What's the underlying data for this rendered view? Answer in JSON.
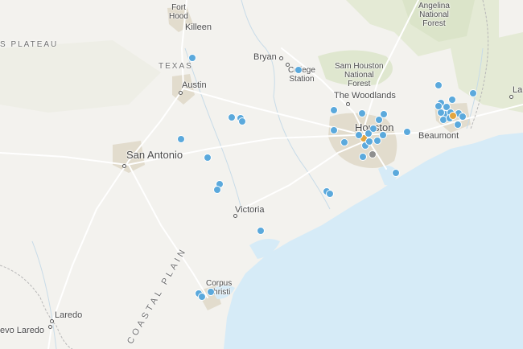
{
  "colors": {
    "water": "#d6ebf7",
    "land": "#f3f2ee",
    "urban": "#e3ddcf",
    "forest": "#e2e8d3",
    "road": "#ffffff",
    "marker_blue": "#5ba9dc",
    "marker_orange": "#e2a540",
    "marker_gray": "#8f8f8f"
  },
  "labels": {
    "fort_hood": "Fort\nHood",
    "killeen": "Killeen",
    "plateau": "S PLATEAU",
    "texas": "TEXAS",
    "austin": "Austin",
    "bryan": "Bryan",
    "college_station": "College\nStation",
    "sam_houston": "Sam Houston\nNational\nForest",
    "angelina": "Angelina\nNational\nForest",
    "woodlands": "The Woodlands",
    "houston": "Houston",
    "beaumont": "Beaumont",
    "la": "La",
    "san_antonio": "San Antonio",
    "victoria": "Victoria",
    "coastal_plain": "COASTAL PLAIN",
    "corpus": "Corpus\nChristi",
    "laredo": "Laredo",
    "nuevo_laredo": "evo Laredo"
  },
  "markers": [
    {
      "color": "blue"
    },
    {
      "color": "blue"
    },
    {
      "color": "blue"
    },
    {
      "color": "blue"
    },
    {
      "color": "blue"
    },
    {
      "color": "blue"
    },
    {
      "color": "blue"
    },
    {
      "color": "blue"
    },
    {
      "color": "blue"
    },
    {
      "color": "blue"
    },
    {
      "color": "blue"
    },
    {
      "color": "blue"
    },
    {
      "color": "blue"
    },
    {
      "color": "blue"
    },
    {
      "color": "blue"
    },
    {
      "color": "blue"
    },
    {
      "color": "blue"
    },
    {
      "color": "blue"
    },
    {
      "color": "blue"
    },
    {
      "color": "blue"
    },
    {
      "color": "blue"
    },
    {
      "color": "blue"
    },
    {
      "color": "blue"
    },
    {
      "color": "orange"
    },
    {
      "color": "gray"
    },
    {
      "color": "blue"
    },
    {
      "color": "blue"
    },
    {
      "color": "blue"
    },
    {
      "color": "blue"
    },
    {
      "color": "blue"
    },
    {
      "color": "blue"
    },
    {
      "color": "blue"
    },
    {
      "color": "blue"
    },
    {
      "color": "blue"
    },
    {
      "color": "blue"
    },
    {
      "color": "blue"
    },
    {
      "color": "blue"
    },
    {
      "color": "blue"
    },
    {
      "color": "blue"
    },
    {
      "color": "blue"
    },
    {
      "color": "blue"
    },
    {
      "color": "blue"
    },
    {
      "color": "blue"
    },
    {
      "color": "orange"
    },
    {
      "color": "blue"
    },
    {
      "color": "blue"
    },
    {
      "color": "blue"
    },
    {
      "color": "blue"
    }
  ]
}
